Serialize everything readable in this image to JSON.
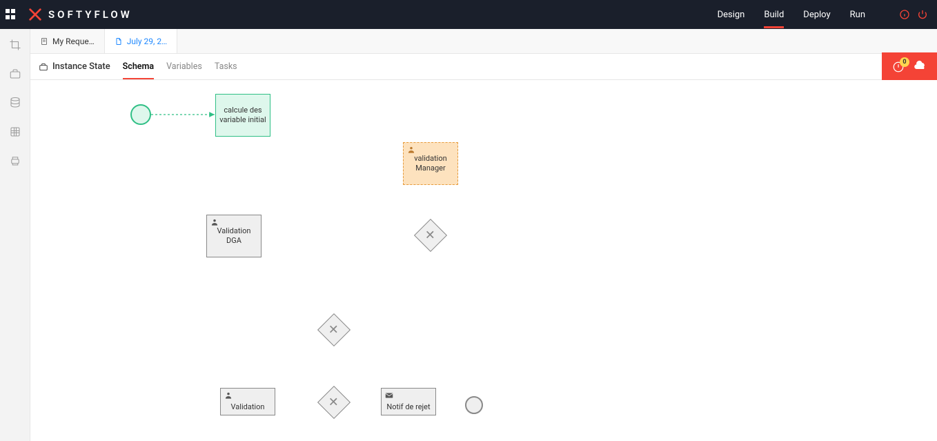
{
  "brand": "SOFTYFLOW",
  "topnav": {
    "design": "Design",
    "build": "Build",
    "deploy": "Deploy",
    "run": "Run"
  },
  "tabs": [
    {
      "label": "My Reque…",
      "active": false
    },
    {
      "label": "July 29, 2…",
      "active": true
    }
  ],
  "toolbar": {
    "title": "Instance State",
    "subtabs": {
      "schema": "Schema",
      "variables": "Variables",
      "tasks": "Tasks"
    },
    "alert_count": "0"
  },
  "nodes": {
    "script_task": "calcule des variable initial",
    "validation_manager": "validation Manager",
    "validation_dga": "Validation DGA",
    "validation": "Validation",
    "notif_rejet": "Notif de rejet"
  }
}
